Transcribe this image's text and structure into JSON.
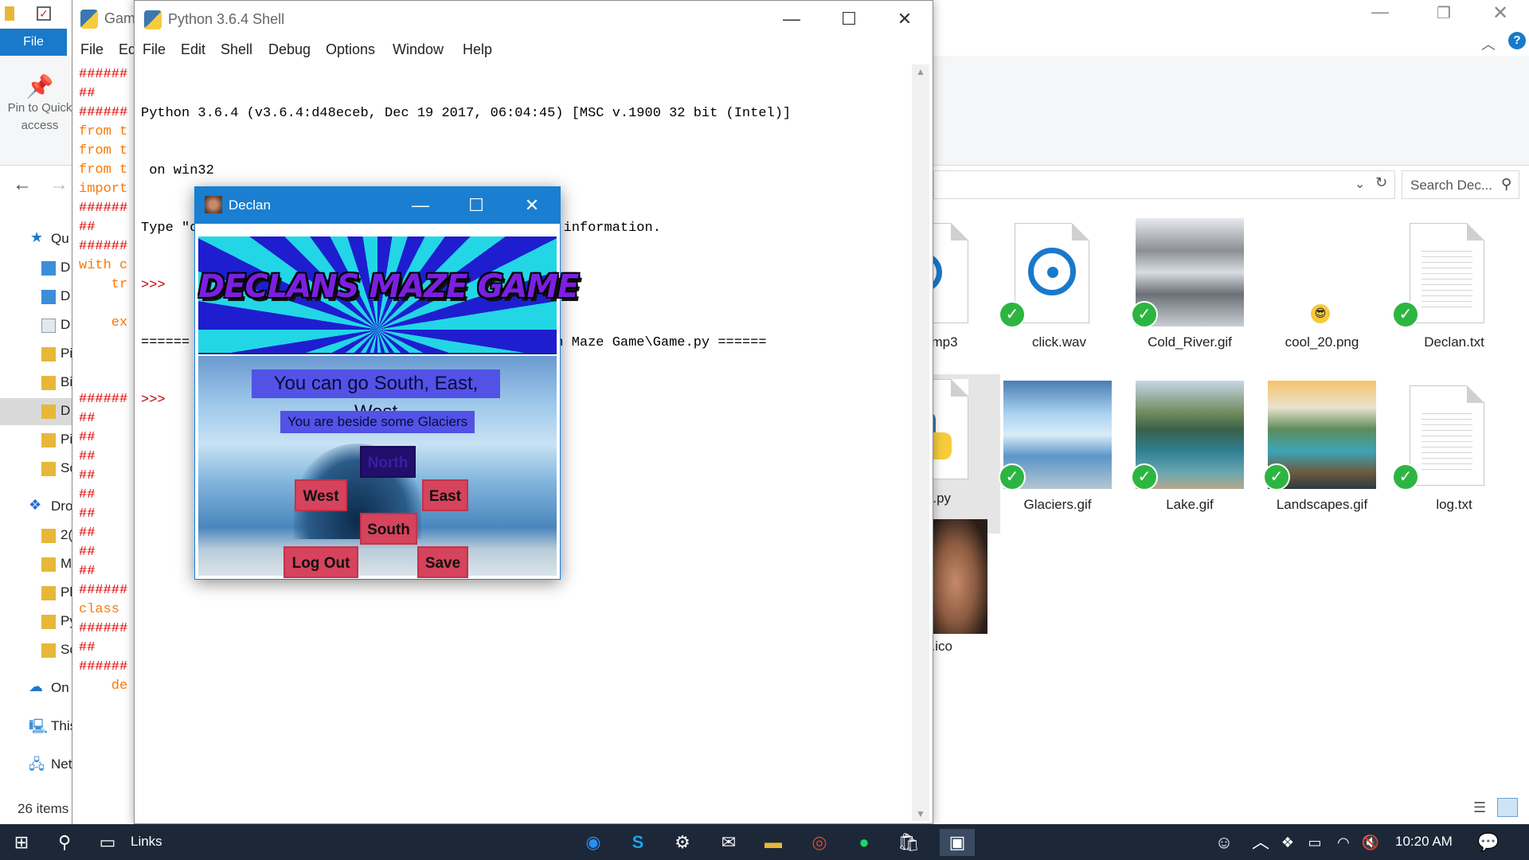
{
  "explorer": {
    "file_tab": "File",
    "pin": "Pin to Quick access",
    "search_placeholder": "Search Dec...",
    "status": "26 items",
    "nav": [
      "Qu",
      "D",
      "D",
      "D",
      "Pi",
      "Bi",
      "D",
      "Pi",
      "Sc",
      "Dro",
      "2(",
      "M",
      "Pl",
      "Py",
      "Sc",
      "On",
      "This",
      "Net"
    ],
    "files_row1": [
      {
        "name": "mp3",
        "icon": "audio-icon"
      },
      {
        "name": "click.wav",
        "icon": "audio-icon"
      },
      {
        "name": "Cold_River.gif",
        "icon": "image-icon"
      },
      {
        "name": "cool_20.png",
        "icon": "image-icon"
      },
      {
        "name": "Declan.txt",
        "icon": "text-file-icon"
      }
    ],
    "files_row2": [
      {
        "name": "e.py",
        "icon": "python-file-icon"
      },
      {
        "name": "Glaciers.gif",
        "icon": "image-icon"
      },
      {
        "name": "Lake.gif",
        "icon": "image-icon"
      },
      {
        "name": "Landscapes.gif",
        "icon": "image-icon"
      },
      {
        "name": "log.txt",
        "icon": "text-file-icon"
      }
    ],
    "files_row3": [
      {
        "name": "a.ico",
        "icon": "image-icon"
      }
    ]
  },
  "editor": {
    "title": "Gam",
    "menu": [
      "File",
      "Ed"
    ],
    "code": [
      "######",
      "##",
      "######",
      "from t",
      "from t",
      "from t",
      "import",
      "######",
      "##",
      "######",
      "with c",
      "    tr",
      "",
      "    ex",
      "",
      "",
      "",
      "######",
      "##",
      "##",
      "##",
      "##",
      "##",
      "##",
      "##",
      "##",
      "##",
      "######",
      "class",
      "######",
      "##",
      "######",
      "    de"
    ]
  },
  "shell": {
    "title": "Python 3.6.4 Shell",
    "menu": [
      "File",
      "Edit",
      "Shell",
      "Debug",
      "Options",
      "Window",
      "Help"
    ],
    "lines": [
      "Python 3.6.4 (v3.6.4:d48eceb, Dec 19 2017, 06:04:45) [MSC v.1900 32 bit (Intel)]",
      " on win32",
      "Type \"copyright\", \"credits\" or \"license()\" for more information.",
      ">>>",
      "====== RESTART: C:\\Users\\bling\\Dropbox\\Python\\Declan Maze Game\\Game.py ======",
      ">>>"
    ]
  },
  "game": {
    "title": "Declan",
    "banner": "DECLANS MAZE GAME",
    "message": "You can go South, East, West",
    "location": "You are beside some Glaciers",
    "buttons": {
      "north": "North",
      "west": "West",
      "east": "East",
      "south": "South",
      "logout": "Log Out",
      "save": "Save"
    }
  },
  "taskbar": {
    "links": "Links",
    "time": "10:20 AM"
  },
  "colors": {
    "taskbar": "#1c2838",
    "accent": "#1979ca",
    "game_button": "#d6435c",
    "game_message_bg": "#5252e6",
    "check": "#2db541"
  }
}
